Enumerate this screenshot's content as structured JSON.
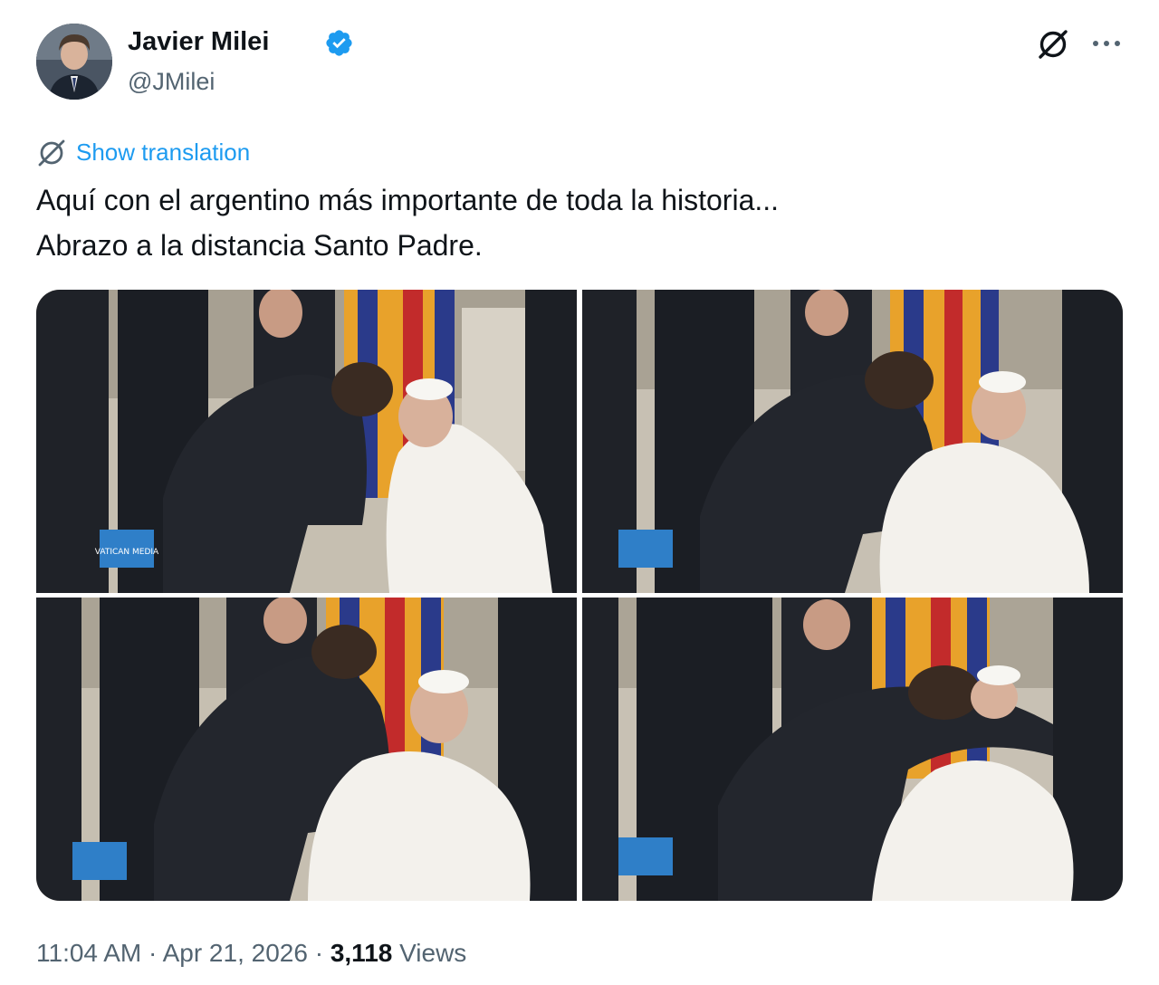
{
  "author": {
    "display_name": "Javier Milei",
    "handle": "@JMilei",
    "verified": true,
    "verified_color": "#1d9bf0"
  },
  "actions": {
    "grok_icon": "grok-icon",
    "more_icon": "more-icon"
  },
  "translate": {
    "label": "Show translation",
    "icon": "translate-icon",
    "color": "#1d9bf0"
  },
  "tweet": {
    "lines": [
      "Aquí con el argentino más importante de toda la historia...",
      "Abrazo a la distancia Santo Padre."
    ]
  },
  "media": {
    "photos": [
      {
        "name": "photo-1",
        "scene": "greeting-lean"
      },
      {
        "name": "photo-2",
        "scene": "hands-on-shoulders"
      },
      {
        "name": "photo-3",
        "scene": "pope-smiling"
      },
      {
        "name": "photo-4",
        "scene": "embrace"
      }
    ],
    "watermark_text": "VATICAN MEDIA"
  },
  "meta": {
    "time": "11:04 AM",
    "separator": " · ",
    "date": "Apr 21, 2026",
    "views_count": "3,118",
    "views_label": " Views"
  }
}
